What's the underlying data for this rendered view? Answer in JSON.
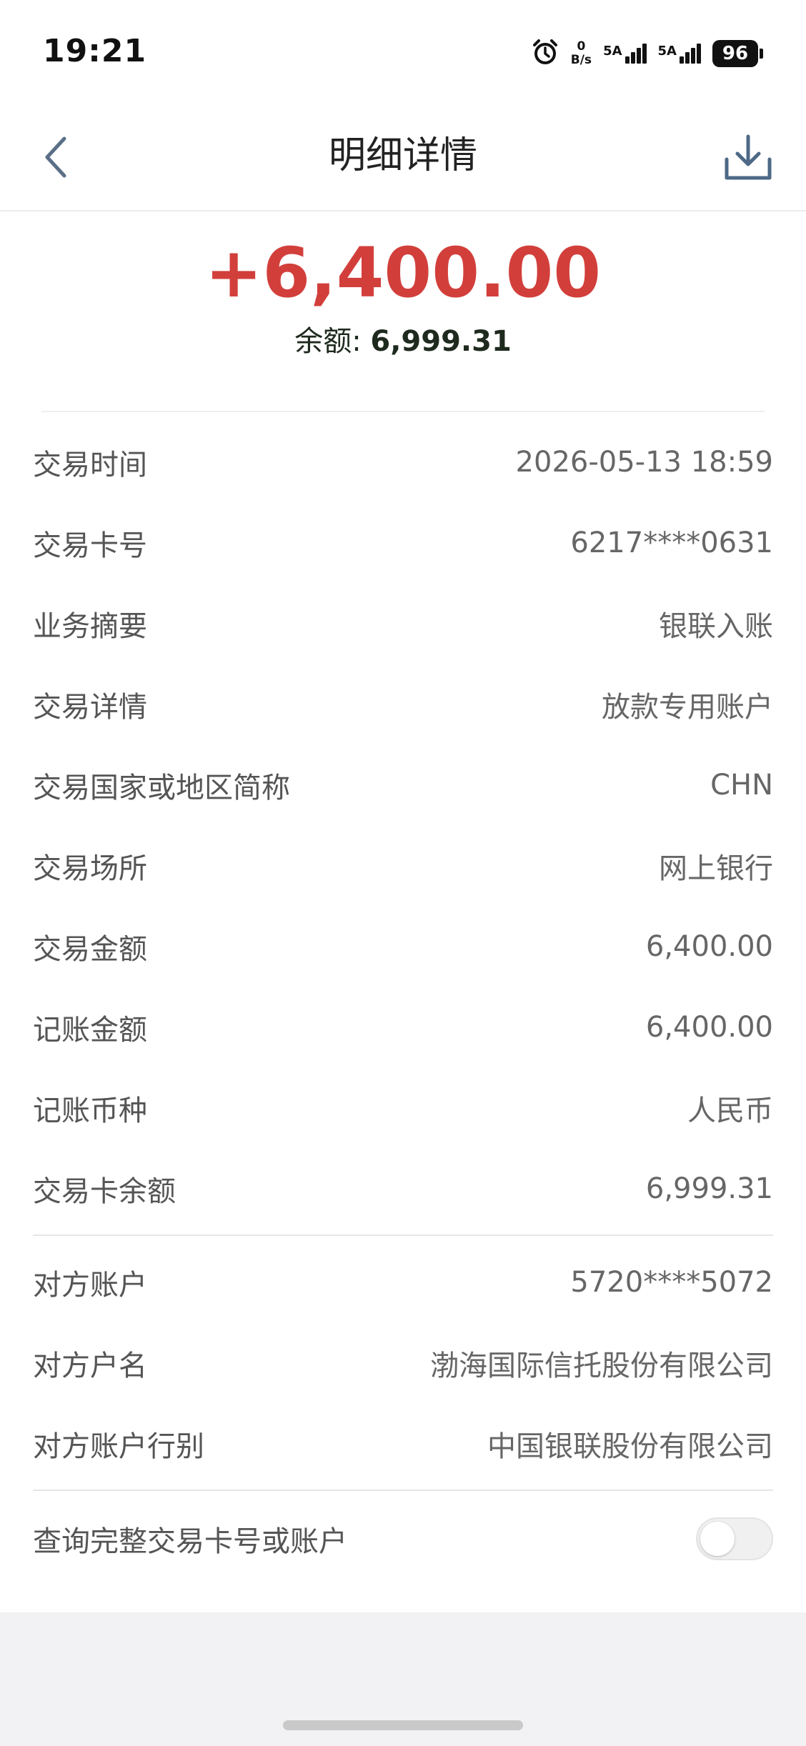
{
  "status_bar": {
    "time": "19:21",
    "net_speed_value": "0",
    "net_speed_unit": "B/s",
    "sim1_label": "5A",
    "sim2_label": "5A",
    "battery": "96"
  },
  "header": {
    "title": "明细详情"
  },
  "summary": {
    "amount": "+6,400.00",
    "balance_label": "余额: ",
    "balance_value": "6,999.31",
    "amount_color": "#d23f3b"
  },
  "details": [
    {
      "label": "交易时间",
      "value": "2026-05-13 18:59"
    },
    {
      "label": "交易卡号",
      "value": "6217****0631"
    },
    {
      "label": "业务摘要",
      "value": "银联入账"
    },
    {
      "label": "交易详情",
      "value": "放款专用账户"
    },
    {
      "label": "交易国家或地区简称",
      "value": "CHN"
    },
    {
      "label": "交易场所",
      "value": "网上银行"
    },
    {
      "label": "交易金额",
      "value": "6,400.00"
    },
    {
      "label": "记账金额",
      "value": "6,400.00"
    },
    {
      "label": "记账币种",
      "value": "人民币"
    },
    {
      "label": "交易卡余额",
      "value": "6,999.31"
    }
  ],
  "counterparty": [
    {
      "label": "对方账户",
      "value": "5720****5072"
    },
    {
      "label": "对方户名",
      "value": "渤海国际信托股份有限公司"
    },
    {
      "label": "对方账户行别",
      "value": "中国银联股份有限公司"
    }
  ],
  "toggle": {
    "label": "查询完整交易卡号或账户",
    "state": "off"
  },
  "icons": {
    "back": "back-arrow-icon",
    "download": "download-icon",
    "alarm": "alarm-icon"
  }
}
